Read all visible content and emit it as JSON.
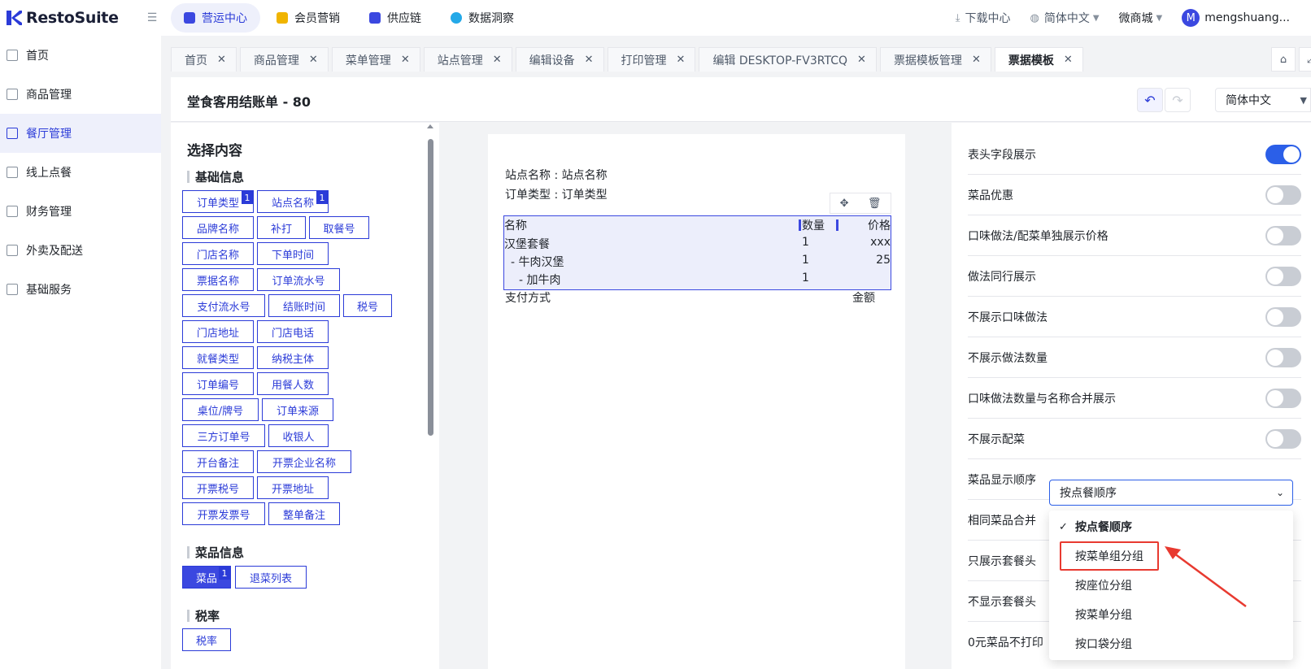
{
  "brand": {
    "name": "RestoSuite"
  },
  "topnav": [
    {
      "label": "营运中心",
      "color": "#3b48e0"
    },
    {
      "label": "会员营销",
      "color": "#f0b400"
    },
    {
      "label": "供应链",
      "color": "#3b48e0"
    },
    {
      "label": "数据洞察",
      "color": "#24a9e8"
    }
  ],
  "top_right": {
    "download": "下载中心",
    "language": "简体中文",
    "shop": "微商城",
    "avatar_letter": "M",
    "username": "mengshuang..."
  },
  "sidebar": [
    {
      "label": "首页"
    },
    {
      "label": "商品管理"
    },
    {
      "label": "餐厅管理"
    },
    {
      "label": "线上点餐"
    },
    {
      "label": "财务管理"
    },
    {
      "label": "外卖及配送"
    },
    {
      "label": "基础服务"
    }
  ],
  "tabs": [
    {
      "label": "首页"
    },
    {
      "label": "商品管理"
    },
    {
      "label": "菜单管理"
    },
    {
      "label": "站点管理"
    },
    {
      "label": "编辑设备"
    },
    {
      "label": "打印管理"
    },
    {
      "label": "编辑 DESKTOP-FV3RTCQ"
    },
    {
      "label": "票据模板管理"
    },
    {
      "label": "票据模板"
    }
  ],
  "header": {
    "title": "堂食客用结账单 - 80",
    "language": "简体中文"
  },
  "left_panel": {
    "title": "选择内容",
    "basic_title": "基础信息",
    "basic_items": [
      "订单类型",
      "站点名称",
      "品牌名称",
      "补打",
      "取餐号",
      "门店名称",
      "下单时间",
      "票据名称",
      "订单流水号",
      "支付流水号",
      "结账时间",
      "税号",
      "门店地址",
      "门店电话",
      "就餐类型",
      "纳税主体",
      "订单编号",
      "用餐人数",
      "桌位/牌号",
      "订单来源",
      "三方订单号",
      "收银人",
      "开台备注",
      "开票企业名称",
      "开票税号",
      "开票地址",
      "开票发票号",
      "整单备注"
    ],
    "badge": "1",
    "dish_title": "菜品信息",
    "dish_items": [
      "菜品",
      "退菜列表"
    ],
    "tax_title": "税率",
    "tax_items": [
      "税率"
    ]
  },
  "receipt": {
    "line1": "站点名称 : 站点名称",
    "line2": "订单类型 : 订单类型",
    "headers": [
      "名称",
      "数量",
      "价格"
    ],
    "rows": [
      {
        "name": "汉堡套餐",
        "qty": "1",
        "price": "xxx"
      },
      {
        "name": "- 牛肉汉堡",
        "qty": "1",
        "price": "25"
      },
      {
        "name": "- 加牛肉",
        "qty": "1",
        "price": ""
      }
    ],
    "footer_left": "支付方式",
    "footer_right": "金额"
  },
  "settings": [
    {
      "label": "表头字段展示",
      "on": true
    },
    {
      "label": "菜品优惠",
      "on": false
    },
    {
      "label": "口味做法/配菜单独展示价格",
      "on": false
    },
    {
      "label": "做法同行展示",
      "on": false
    },
    {
      "label": "不展示口味做法",
      "on": false
    },
    {
      "label": "不展示做法数量",
      "on": false
    },
    {
      "label": "口味做法数量与名称合并展示",
      "on": false
    },
    {
      "label": "不展示配菜",
      "on": false
    },
    {
      "label": "菜品显示顺序"
    },
    {
      "label": "相同菜品合并"
    },
    {
      "label": "只展示套餐头"
    },
    {
      "label": "不显示套餐头"
    },
    {
      "label": "0元菜品不打印"
    }
  ],
  "order_select": {
    "value": "按点餐顺序",
    "options": [
      "按点餐顺序",
      "按菜单组分组",
      "按座位分组",
      "按菜单分组",
      "按口袋分组"
    ]
  }
}
